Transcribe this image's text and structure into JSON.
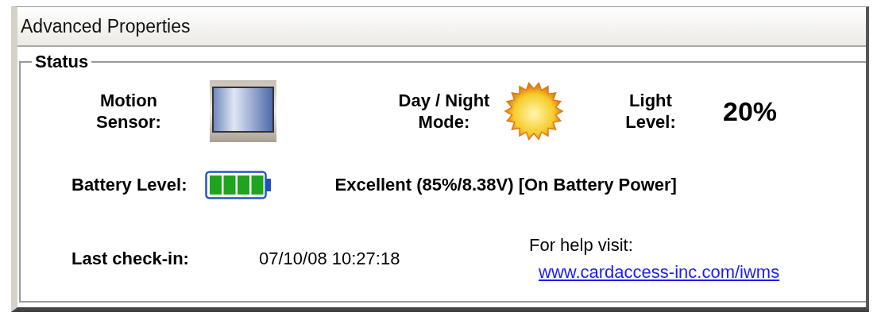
{
  "window": {
    "title": "Advanced Properties"
  },
  "status": {
    "title": "Status",
    "motion_sensor": {
      "label": "Motion\nSensor:"
    },
    "day_night": {
      "label": "Day / Night\nMode:",
      "night": false
    },
    "light_level": {
      "label": "Light\nLevel:",
      "value": "20%"
    },
    "battery": {
      "label": "Battery Level:",
      "level": 1,
      "description": "Excellent (85%/8.38V) [On Battery Power]"
    },
    "last_check_in": {
      "label": "Last check-in:",
      "value": "07/10/08 10:27:18"
    },
    "help": {
      "text": "For help visit:",
      "link": "www.cardaccess-inc.com/iwms"
    }
  }
}
